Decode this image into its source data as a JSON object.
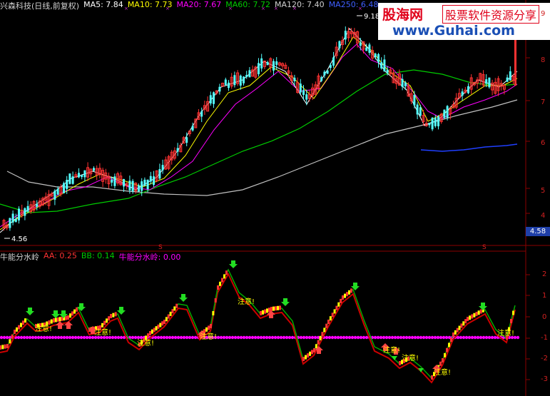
{
  "stock": {
    "name": "兴森科技(日线,前复权)",
    "ma5": "MA5: 7.84",
    "ma10": "MA10: 7.73",
    "ma20": "MA20: 7.67",
    "ma60": "MA60: 7.72",
    "ma120": "MA120: 7.40",
    "ma250": "MA250: 6.48"
  },
  "indicator": {
    "name": "牛能分水岭",
    "aa": "AA: 0.25",
    "bb": "BB: 0.14",
    "line": "牛能分水岭: 0.00"
  },
  "logo": {
    "main": "股海网",
    "sub": "股票软件资源分享",
    "url": "www.Guhai.com"
  },
  "price_axis": [
    "9",
    "8",
    "7",
    "6",
    "5",
    "4"
  ],
  "indicator_axis": [
    "2",
    "1",
    "0",
    "-1",
    "-2",
    "-3"
  ],
  "annotations": {
    "high": "9.18",
    "low": "4.56",
    "current": "4.58",
    "s_marker": "S"
  },
  "signals": {
    "caution": "注意!"
  },
  "colors": {
    "ma5": "#ffffff",
    "ma10": "#ffff00",
    "ma20": "#ff00ff",
    "ma60": "#00cc00",
    "ma120": "#c0c0c0",
    "ma250": "#1f3fff",
    "up_candle": "#ff3232",
    "down_candle": "#54ffff",
    "divider": "#8b0000"
  }
}
